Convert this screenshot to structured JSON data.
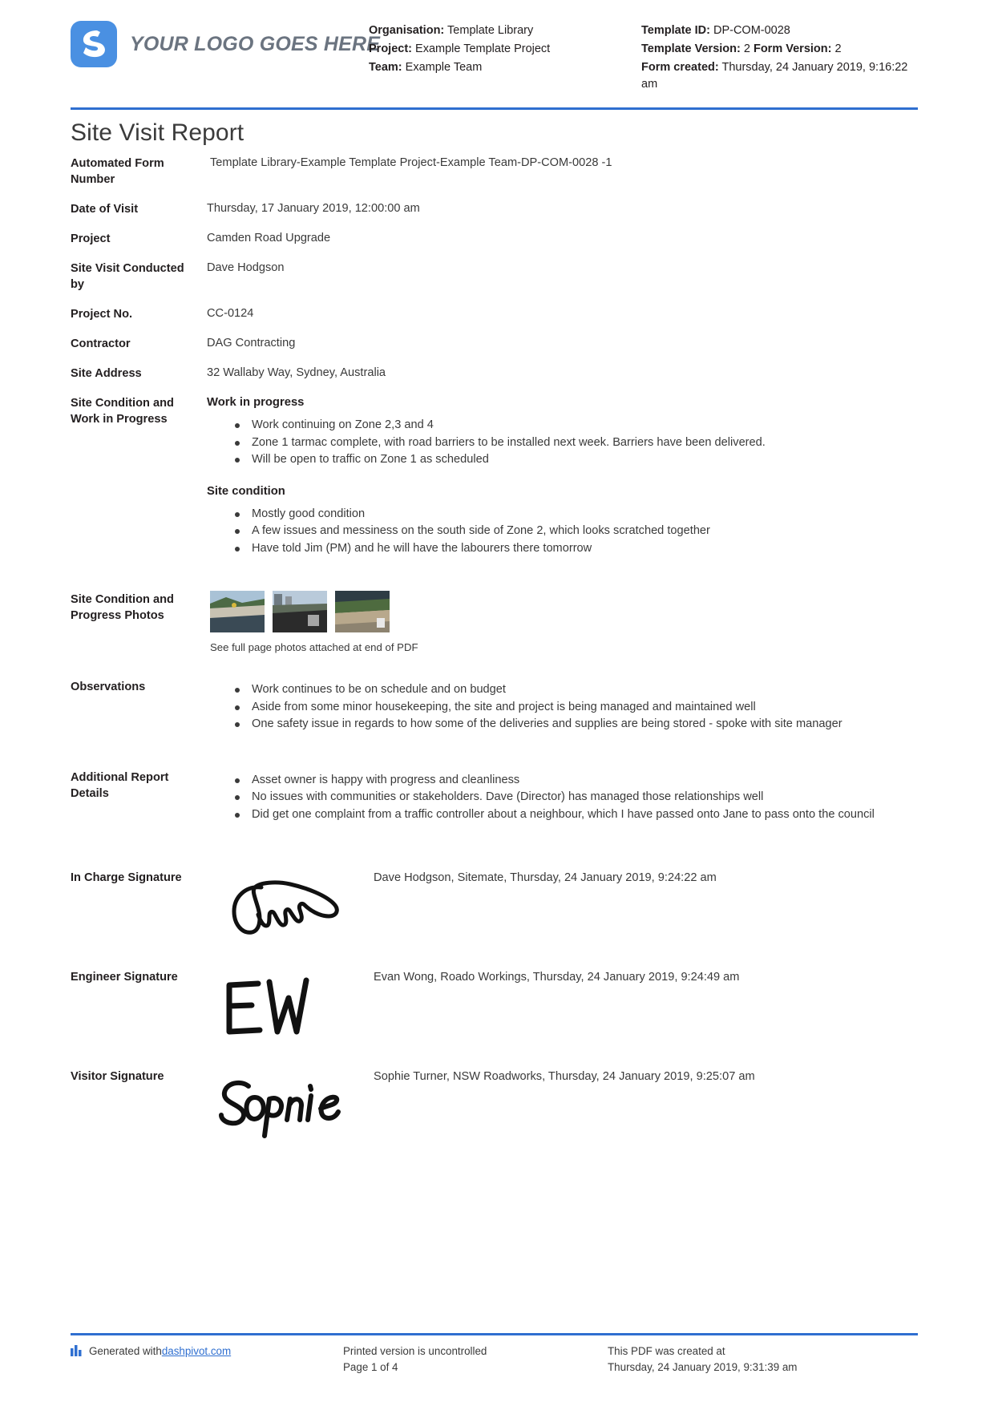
{
  "header": {
    "logo_text": "YOUR LOGO GOES HERE",
    "left_meta": [
      {
        "label": "Organisation:",
        "value": "Template Library"
      },
      {
        "label": "Project:",
        "value": "Example Template Project"
      },
      {
        "label": "Team:",
        "value": "Example Team"
      }
    ],
    "template_id_label": "Template ID:",
    "template_id_value": "DP-COM-0028",
    "template_version_label": "Template Version:",
    "template_version_value": "2",
    "form_version_label": "Form Version:",
    "form_version_value": "2",
    "form_created_label": "Form created:",
    "form_created_value": "Thursday, 24 January 2019, 9:16:22 am"
  },
  "title": "Site Visit Report",
  "fields": {
    "automated_form_number_label": "Automated Form Number",
    "automated_form_number_value": "Template Library-Example Template Project-Example Team-DP-COM-0028   -1",
    "date_of_visit_label": "Date of Visit",
    "date_of_visit_value": "Thursday, 17 January 2019, 12:00:00 am",
    "project_label": "Project",
    "project_value": "Camden Road Upgrade",
    "conducted_by_label": "Site Visit Conducted by",
    "conducted_by_value": "Dave Hodgson",
    "project_no_label": "Project No.",
    "project_no_value": "CC-0124",
    "contractor_label": "Contractor",
    "contractor_value": "DAG Contracting",
    "site_address_label": "Site Address",
    "site_address_value": "32 Wallaby Way, Sydney, Australia",
    "site_condition_work_label": "Site Condition and Work in Progress",
    "photos_label": "Site Condition and Progress Photos",
    "observations_label": "Observations",
    "additional_label": "Additional Report Details"
  },
  "work_in_progress": {
    "heading": "Work in progress",
    "items": [
      "Work continuing on Zone 2,3 and 4",
      "Zone 1 tarmac complete, with road barriers to be installed next week. Barriers have been delivered.",
      "Will be open to traffic on Zone 1 as scheduled"
    ]
  },
  "site_condition": {
    "heading": "Site condition",
    "items": [
      "Mostly good condition",
      "A few issues and messiness on the south side of Zone 2, which looks scratched together",
      "Have told Jim (PM) and he will have the labourers there tomorrow"
    ]
  },
  "photos": {
    "caption": "See full page photos attached at end of PDF",
    "count": 3
  },
  "observations": {
    "items": [
      "Work continues to be on schedule and on budget",
      "Aside from some minor housekeeping, the site and project is being managed and maintained well",
      "One safety issue in regards to how some of the deliveries and supplies are being stored - spoke with site manager"
    ]
  },
  "additional_report_details": {
    "items": [
      "Asset owner is happy with progress and cleanliness",
      "No issues with communities or stakeholders. Dave (Director) has managed those relationships well",
      "Did get one complaint from a traffic controller about a neighbour, which I have passed onto Jane to pass onto the council"
    ]
  },
  "signatures": [
    {
      "label": "In Charge Signature",
      "meta": "Dave Hodgson, Sitemate, Thursday, 24 January 2019, 9:24:22 am",
      "name": "signature-in-charge"
    },
    {
      "label": "Engineer Signature",
      "meta": "Evan Wong, Roado Workings, Thursday, 24 January 2019, 9:24:49 am",
      "name": "signature-engineer"
    },
    {
      "label": "Visitor Signature",
      "meta": "Sophie Turner, NSW Roadworks, Thursday, 24 January 2019, 9:25:07 am",
      "name": "signature-visitor"
    }
  ],
  "footer": {
    "generated_prefix": "Generated with ",
    "generated_link": "dashpivot.com",
    "uncontrolled": "Printed version is uncontrolled",
    "page": "Page 1 of 4",
    "created_label": "This PDF was created at",
    "created_value": "Thursday, 24 January 2019, 9:31:39 am"
  },
  "colors": {
    "accent_blue": "#2f6fd0",
    "logo_blue": "#4a90e2",
    "text": "#231f20"
  }
}
